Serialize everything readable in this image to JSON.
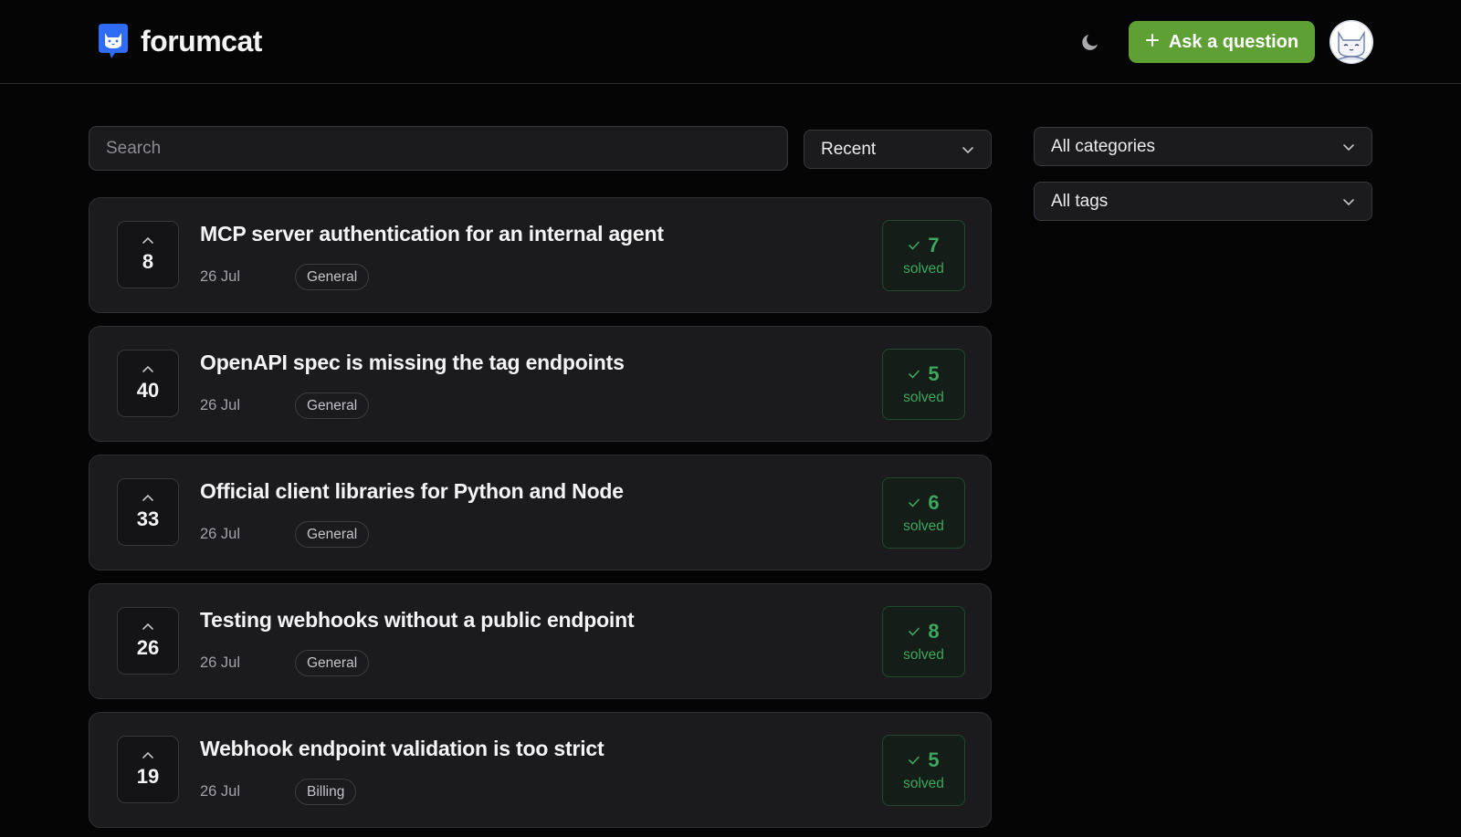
{
  "brand": {
    "name": "forumcat"
  },
  "header": {
    "ask_button_label": "Ask a question",
    "accent_color": "#5fa035"
  },
  "filters": {
    "search_placeholder": "Search",
    "sort_selected": "Recent",
    "category_selected": "All categories",
    "tags_selected": "All tags"
  },
  "posts": [
    {
      "votes": "8",
      "title": "MCP server authentication for an internal agent",
      "date": "26 Jul",
      "tag": "General",
      "answers": "7",
      "status": "solved"
    },
    {
      "votes": "40",
      "title": "OpenAPI spec is missing the tag endpoints",
      "date": "26 Jul",
      "tag": "General",
      "answers": "5",
      "status": "solved"
    },
    {
      "votes": "33",
      "title": "Official client libraries for Python and Node",
      "date": "26 Jul",
      "tag": "General",
      "answers": "6",
      "status": "solved"
    },
    {
      "votes": "26",
      "title": "Testing webhooks without a public endpoint",
      "date": "26 Jul",
      "tag": "General",
      "answers": "8",
      "status": "solved"
    },
    {
      "votes": "19",
      "title": "Webhook endpoint validation is too strict",
      "date": "26 Jul",
      "tag": "Billing",
      "answers": "5",
      "status": "solved"
    }
  ],
  "colors": {
    "solved": "#3ea65e",
    "background": "#050506",
    "card": "#1b1b1e"
  },
  "icons": [
    "forumcat-logo-icon",
    "moon-icon",
    "plus-icon",
    "cat-avatar-icon",
    "chevron-down-icon",
    "chevron-up-icon",
    "check-icon"
  ]
}
